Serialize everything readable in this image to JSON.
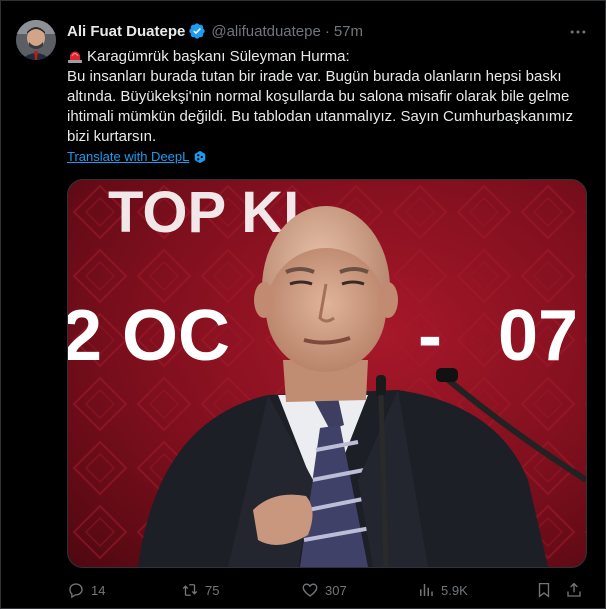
{
  "tweet": {
    "author_name": "Ali Fuat Duatepe",
    "handle": "@alifuatduatepe",
    "separator": "·",
    "time": "57m",
    "text_line1": "Karagümrük başkanı Süleyman Hurma:",
    "text_body": "Bu insanları burada tutan bir irade var. Bugün burada olanların hepsi baskı altında. Büyükekşi'nin normal koşullarda bu salona misafir olarak bile gelme ihtimali mümkün değildi. Bu tablodan utanmalıyız. Sayın Cumhurbaşkanımız bizi kurtarsın.",
    "translate_label": "Translate with DeepL",
    "media_banner_text": {
      "row1": "TOP KI",
      "row2_left": "2 OC",
      "row2_dash": "-",
      "row2_right": "07"
    }
  },
  "actions": {
    "replies": "14",
    "reposts": "75",
    "likes": "307",
    "views": "5.9K"
  },
  "icons": {
    "verified": "verified-badge-icon",
    "more": "more-options-icon",
    "siren": "siren-emoji-icon",
    "deepl": "deepl-icon",
    "reply": "reply-icon",
    "repost": "repost-icon",
    "like": "heart-icon",
    "views": "views-chart-icon",
    "bookmark": "bookmark-icon",
    "share": "share-icon"
  },
  "colors": {
    "background": "#000000",
    "text": "#e7e9ea",
    "muted": "#71767b",
    "accent": "#1d9bf0",
    "banner_red": "#8c1020"
  }
}
